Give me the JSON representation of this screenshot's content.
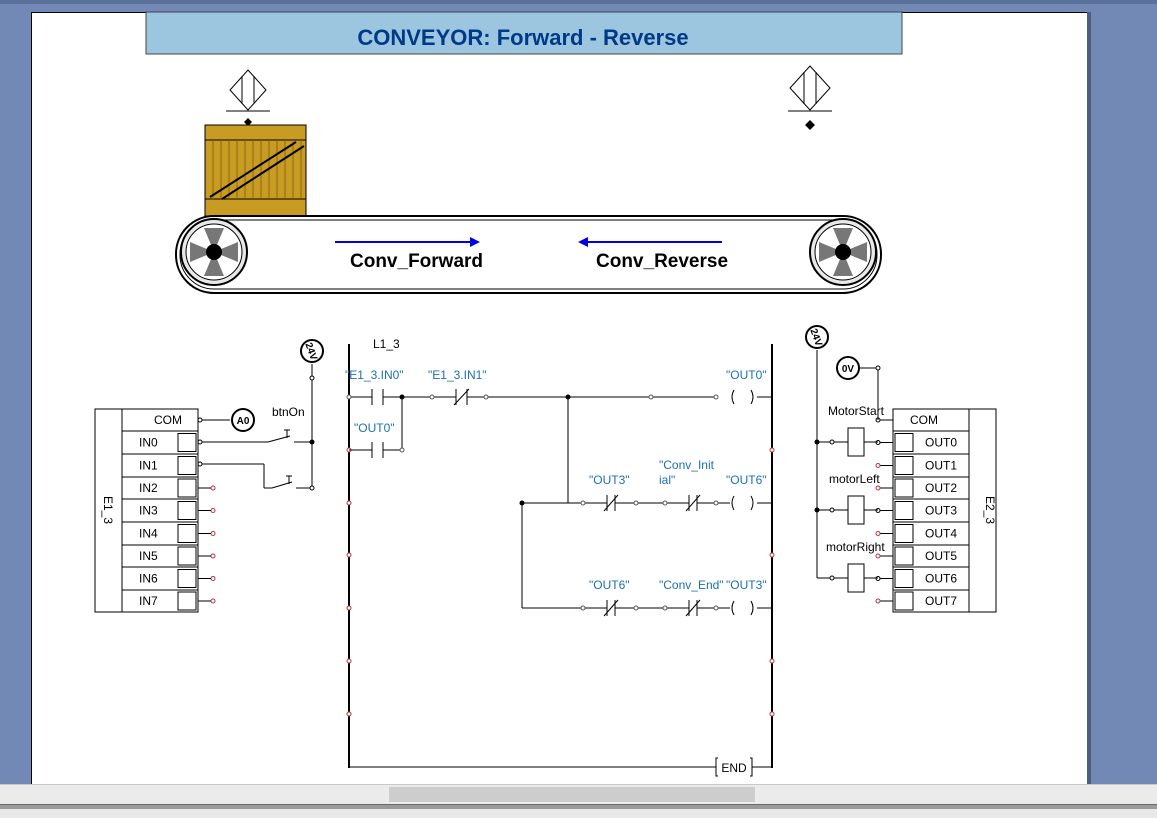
{
  "title": "CONVEYOR: Forward  - Reverse",
  "conveyor": {
    "forward_label": "Conv_Forward",
    "reverse_label": "Conv_Reverse"
  },
  "input_module": {
    "name": "E1_3",
    "com": "COM",
    "channels": [
      "IN0",
      "IN1",
      "IN2",
      "IN3",
      "IN4",
      "IN5",
      "IN6",
      "IN7"
    ],
    "com_badge": "A0",
    "supply_badge": "24V",
    "button_label": "btnOn"
  },
  "output_module": {
    "name": "E2_3",
    "com": "COM",
    "channels": [
      "OUT0",
      "OUT1",
      "OUT2",
      "OUT3",
      "OUT4",
      "OUT5",
      "OUT6",
      "OUT7"
    ],
    "supply_badge": "24V",
    "ground_badge": "0V",
    "loads": [
      "MotorStart",
      "motorLeft",
      "motorRight"
    ]
  },
  "ladder": {
    "rail_label": "L1_3",
    "rung1": {
      "contact_a": "\"E1_3.IN0\"",
      "contact_b": "\"E1_3.IN1\"",
      "latch": "\"OUT0\"",
      "coil": "\"OUT0\""
    },
    "rung2": {
      "contact_a": "\"OUT3\"",
      "contact_b_line1": "\"Conv_Init",
      "contact_b_line2": "ial\"",
      "coil": "\"OUT6\""
    },
    "rung3": {
      "contact_a": "\"OUT6\"",
      "contact_b": "\"Conv_End\"",
      "coil": "\"OUT3\""
    },
    "end_label": "END"
  },
  "colors": {
    "title_bg": "#9cc6e0",
    "title_text": "#003a87",
    "arrow": "#0000e0",
    "tag": "#1c6fb3",
    "box_wood": "#c89b22",
    "frame": "#7189b4"
  }
}
